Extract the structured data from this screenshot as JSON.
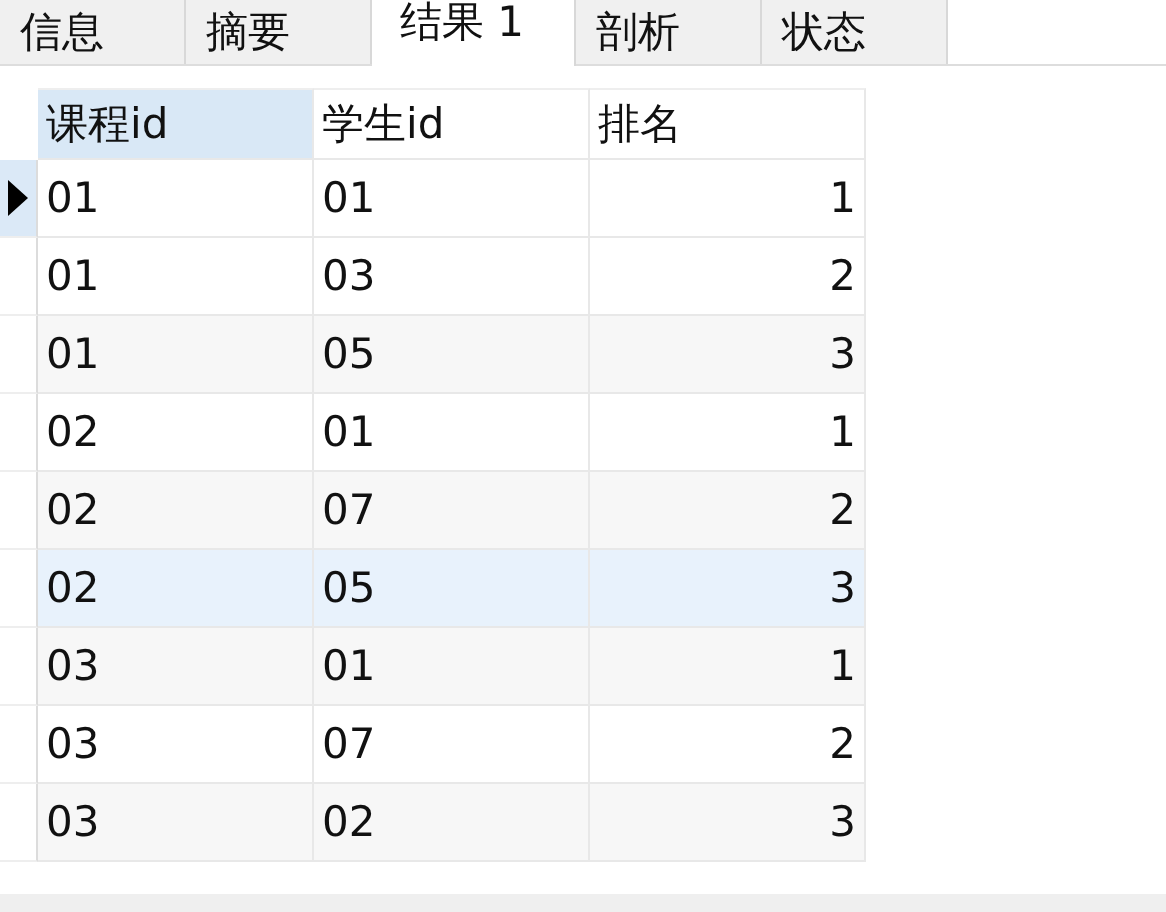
{
  "tabs": [
    {
      "label": "信息",
      "selected": false
    },
    {
      "label": "摘要",
      "selected": false
    },
    {
      "label": "结果 1",
      "selected": true
    },
    {
      "label": "剖析",
      "selected": false
    },
    {
      "label": "状态",
      "selected": false
    }
  ],
  "table": {
    "columns": [
      {
        "label": "课程id",
        "selected": true
      },
      {
        "label": "学生id",
        "selected": false
      },
      {
        "label": "排名",
        "selected": false
      }
    ],
    "rows": [
      {
        "cells": [
          "01",
          "01",
          "1"
        ],
        "selected": true,
        "highlighted": false
      },
      {
        "cells": [
          "01",
          "03",
          "2"
        ],
        "selected": false,
        "highlighted": false
      },
      {
        "cells": [
          "01",
          "05",
          "3"
        ],
        "selected": false,
        "highlighted": false
      },
      {
        "cells": [
          "02",
          "01",
          "1"
        ],
        "selected": false,
        "highlighted": false
      },
      {
        "cells": [
          "02",
          "07",
          "2"
        ],
        "selected": false,
        "highlighted": false
      },
      {
        "cells": [
          "02",
          "05",
          "3"
        ],
        "selected": false,
        "highlighted": true
      },
      {
        "cells": [
          "03",
          "01",
          "1"
        ],
        "selected": false,
        "highlighted": false
      },
      {
        "cells": [
          "03",
          "07",
          "2"
        ],
        "selected": false,
        "highlighted": false
      },
      {
        "cells": [
          "03",
          "02",
          "3"
        ],
        "selected": false,
        "highlighted": false
      }
    ]
  }
}
